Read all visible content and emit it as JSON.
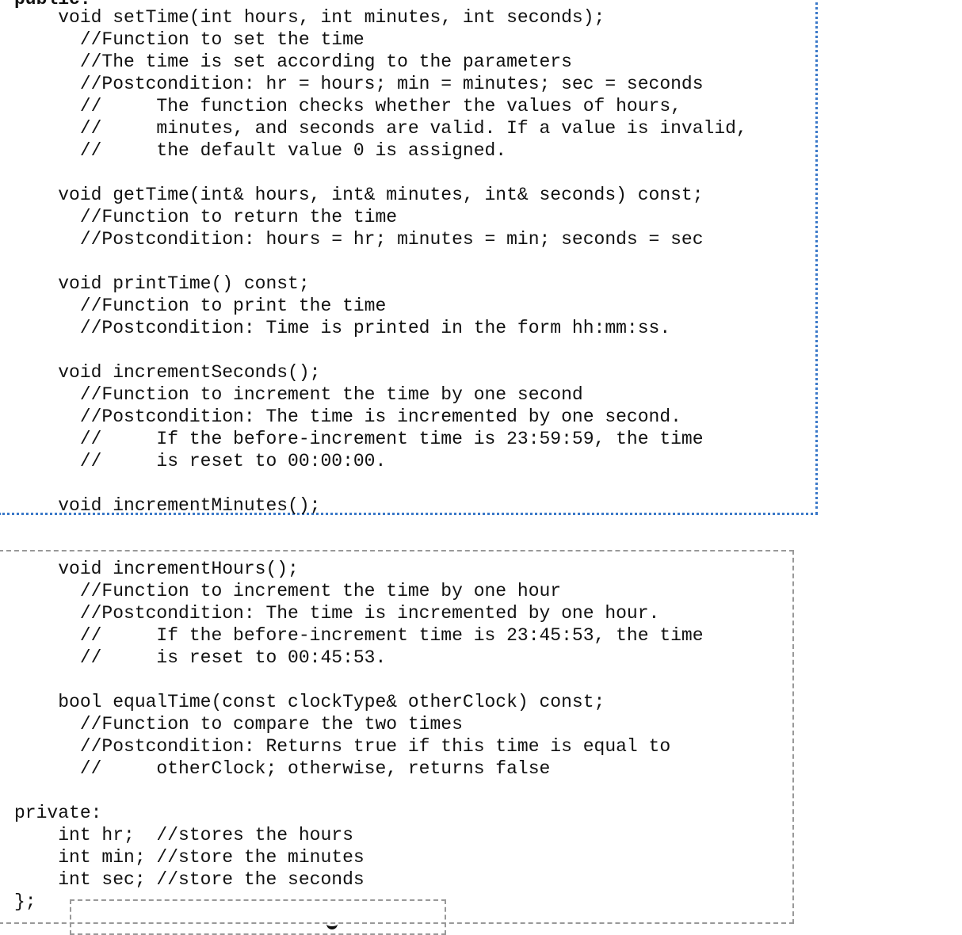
{
  "page": {
    "clipped_heading": "public:",
    "top_section": {
      "lines": [
        "    void setTime(int hours, int minutes, int seconds);",
        "      //Function to set the time",
        "      //The time is set according to the parameters",
        "      //Postcondition: hr = hours; min = minutes; sec = seconds",
        "      //     The function checks whether the values of hours,",
        "      //     minutes, and seconds are valid. If a value is invalid,",
        "      //     the default value 0 is assigned.",
        "",
        "    void getTime(int& hours, int& minutes, int& seconds) const;",
        "      //Function to return the time",
        "      //Postcondition: hours = hr; minutes = min; seconds = sec",
        "",
        "    void printTime() const;",
        "      //Function to print the time",
        "      //Postcondition: Time is printed in the form hh:mm:ss.",
        "",
        "    void incrementSeconds();",
        "      //Function to increment the time by one second",
        "      //Postcondition: The time is incremented by one second.",
        "      //     If the before-increment time is 23:59:59, the time",
        "      //     is reset to 00:00:00.",
        "",
        "    void incrementMinutes();"
      ]
    },
    "bottom_section": {
      "lines": [
        "    void incrementHours();",
        "      //Function to increment the time by one hour",
        "      //Postcondition: The time is incremented by one hour.",
        "      //     If the before-increment time is 23:45:53, the time",
        "      //     is reset to 00:45:53.",
        "",
        "    bool equalTime(const clockType& otherClock) const;",
        "      //Function to compare the two times",
        "      //Postcondition: Returns true if this time is equal to",
        "      //     otherClock; otherwise, returns false",
        "",
        "private:",
        "    int hr;  //stores the hours",
        "    int min; //store the minutes",
        "    int sec; //store the seconds",
        "};"
      ]
    },
    "colors": {
      "top_border": "#3a78c8",
      "bottom_border": "#999999",
      "text": "#111111"
    }
  }
}
